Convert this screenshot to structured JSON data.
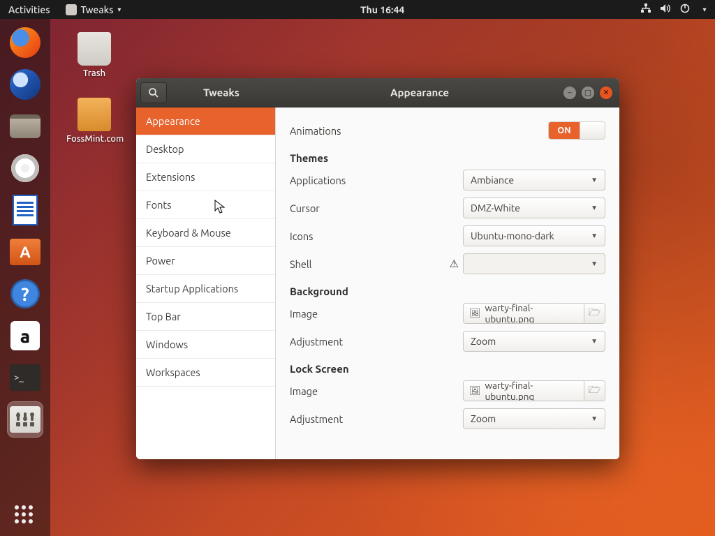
{
  "panel": {
    "activities": "Activities",
    "app_name": "Tweaks",
    "clock": "Thu 16:44"
  },
  "desktop_icons": {
    "trash": "Trash",
    "folder1": "FossMint.com"
  },
  "window": {
    "app_title": "Tweaks",
    "page_title": "Appearance"
  },
  "sidebar": {
    "items": [
      "Appearance",
      "Desktop",
      "Extensions",
      "Fonts",
      "Keyboard & Mouse",
      "Power",
      "Startup Applications",
      "Top Bar",
      "Windows",
      "Workspaces"
    ],
    "selected_index": 0
  },
  "content": {
    "animations_label": "Animations",
    "animations_switch": "ON",
    "section_themes": "Themes",
    "applications_label": "Applications",
    "applications_value": "Ambiance",
    "cursor_label": "Cursor",
    "cursor_value": "DMZ-White",
    "icons_label": "Icons",
    "icons_value": "Ubuntu-mono-dark",
    "shell_label": "Shell",
    "shell_value": "",
    "section_background": "Background",
    "bg_image_label": "Image",
    "bg_image_value": "warty-final-ubuntu.png",
    "bg_adjust_label": "Adjustment",
    "bg_adjust_value": "Zoom",
    "section_lock": "Lock Screen",
    "lock_image_label": "Image",
    "lock_image_value": "warty-final-ubuntu.png",
    "lock_adjust_label": "Adjustment",
    "lock_adjust_value": "Zoom"
  }
}
